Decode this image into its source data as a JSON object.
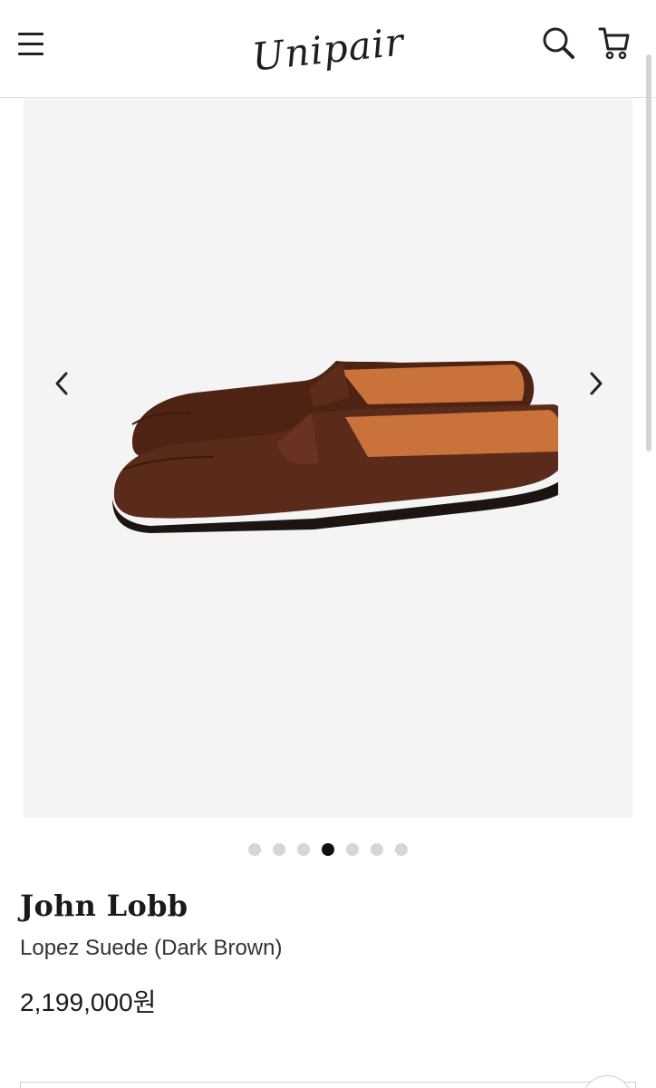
{
  "header": {
    "logo_text": "Unipair",
    "menu_icon": "hamburger-menu-icon",
    "search_icon": "search-icon",
    "cart_icon": "cart-icon"
  },
  "gallery": {
    "prev_icon": "chevron-left-icon",
    "next_icon": "chevron-right-icon",
    "image_subject": "brown suede penny loafers",
    "total_images": 7,
    "active_index": 3
  },
  "product": {
    "brand": "John Lobb",
    "name": "Lopez Suede (Dark Brown)",
    "price": "2,199,000원"
  },
  "colors": {
    "shoe": "#5a2a1a",
    "lining": "#c9733a",
    "background": "#f4f4f4",
    "dot_active": "#111111",
    "dot_inactive": "#d6d6d6"
  }
}
